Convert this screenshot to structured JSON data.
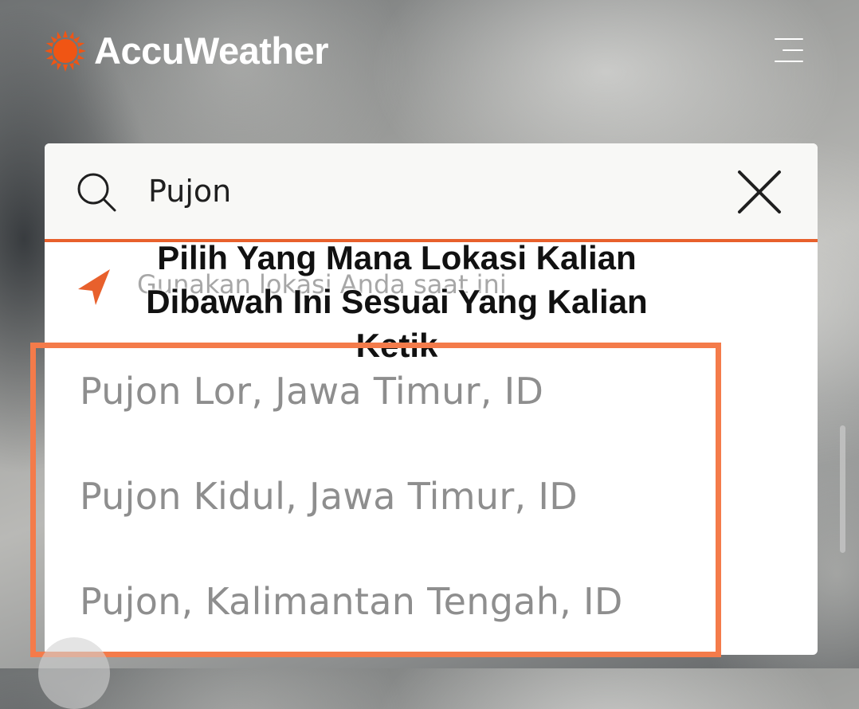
{
  "app": {
    "brand_name": "AccuWeather",
    "brand_color": "#f05514",
    "accent_color": "#e8602c"
  },
  "header": {
    "logo_icon": "sun-icon",
    "menu_icon": "hamburger-menu-icon"
  },
  "search": {
    "icon": "search-icon",
    "value": "Pujon",
    "clear_icon": "close-icon",
    "use_location": {
      "icon": "location-arrow-icon",
      "label": "Gunakan lokasi Anda saat ini"
    },
    "results": [
      {
        "label": "Pujon Lor, Jawa Timur, ID"
      },
      {
        "label": "Pujon Kidul, Jawa Timur, ID"
      },
      {
        "label": "Pujon, Kalimantan Tengah, ID"
      }
    ]
  },
  "annotation": {
    "caption": "Pilih Yang Mana Lokasi Kalian Dibawah Ini Sesuai Yang Kalian Ketik",
    "highlight_color": "#f47b4a"
  }
}
